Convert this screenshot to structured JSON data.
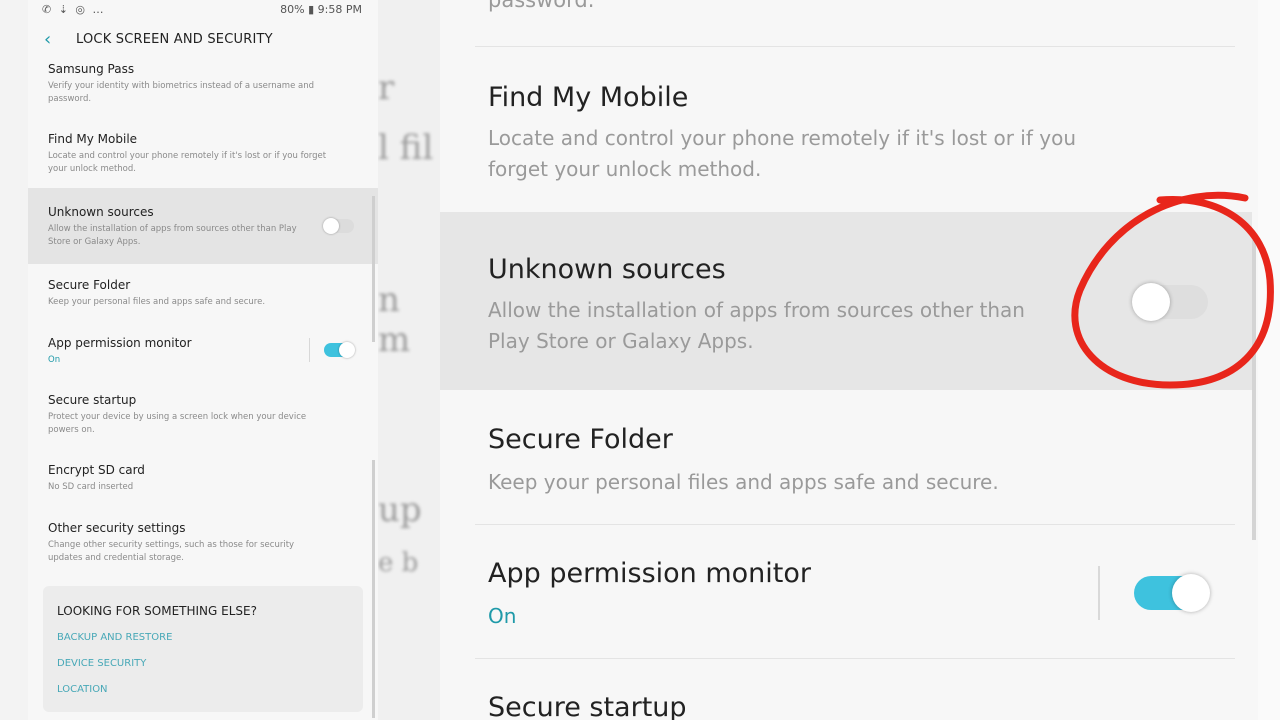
{
  "status_bar": {
    "left_icons": "✆ ⇣ ◎ …",
    "right_text": "80% ▮ 9:58 PM"
  },
  "header": {
    "title": "LOCK SCREEN AND SECURITY"
  },
  "settings": [
    {
      "title": "Samsung Pass",
      "subtitle": "Verify your identity with biometrics instead of a username and password."
    },
    {
      "title": "Find My Mobile",
      "subtitle": "Locate and control your phone remotely if it's lost or if you forget your unlock method."
    },
    {
      "title": "Unknown sources",
      "subtitle": "Allow the installation of apps from sources other than Play Store or Galaxy Apps.",
      "toggle": "off"
    },
    {
      "title": "Secure Folder",
      "subtitle": "Keep your personal files and apps safe and secure."
    },
    {
      "title": "App permission monitor",
      "subtitle": "On",
      "toggle": "on"
    },
    {
      "title": "Secure startup",
      "subtitle": "Protect your device by using a screen lock when your device powers on."
    },
    {
      "title": "Encrypt SD card",
      "subtitle": "No SD card inserted"
    },
    {
      "title": "Other security settings",
      "subtitle": "Change other security settings, such as those for security updates and credential storage."
    }
  ],
  "looking_box": {
    "title": "LOOKING FOR SOMETHING ELSE?",
    "links": [
      "BACKUP AND RESTORE",
      "DEVICE SECURITY",
      "LOCATION"
    ]
  },
  "zoom": {
    "top_subtitle_tail": "password.",
    "find_my_mobile_title": "Find My Mobile",
    "find_my_mobile_sub_1": "Locate and control your phone remotely if it's lost or if you",
    "find_my_mobile_sub_2": "forget your unlock method.",
    "unknown_title": "Unknown sources",
    "unknown_sub_1": "Allow the installation of apps from sources other than",
    "unknown_sub_2": "Play Store or Galaxy Apps.",
    "secure_folder_title": "Secure Folder",
    "secure_folder_sub": "Keep your personal files and apps safe and secure.",
    "apm_title": "App permission monitor",
    "apm_sub": "On",
    "secure_startup_title": "Secure startup"
  },
  "colors": {
    "accent": "#3ec2de",
    "link": "#47a8b7",
    "annotation": "#e8261b"
  }
}
